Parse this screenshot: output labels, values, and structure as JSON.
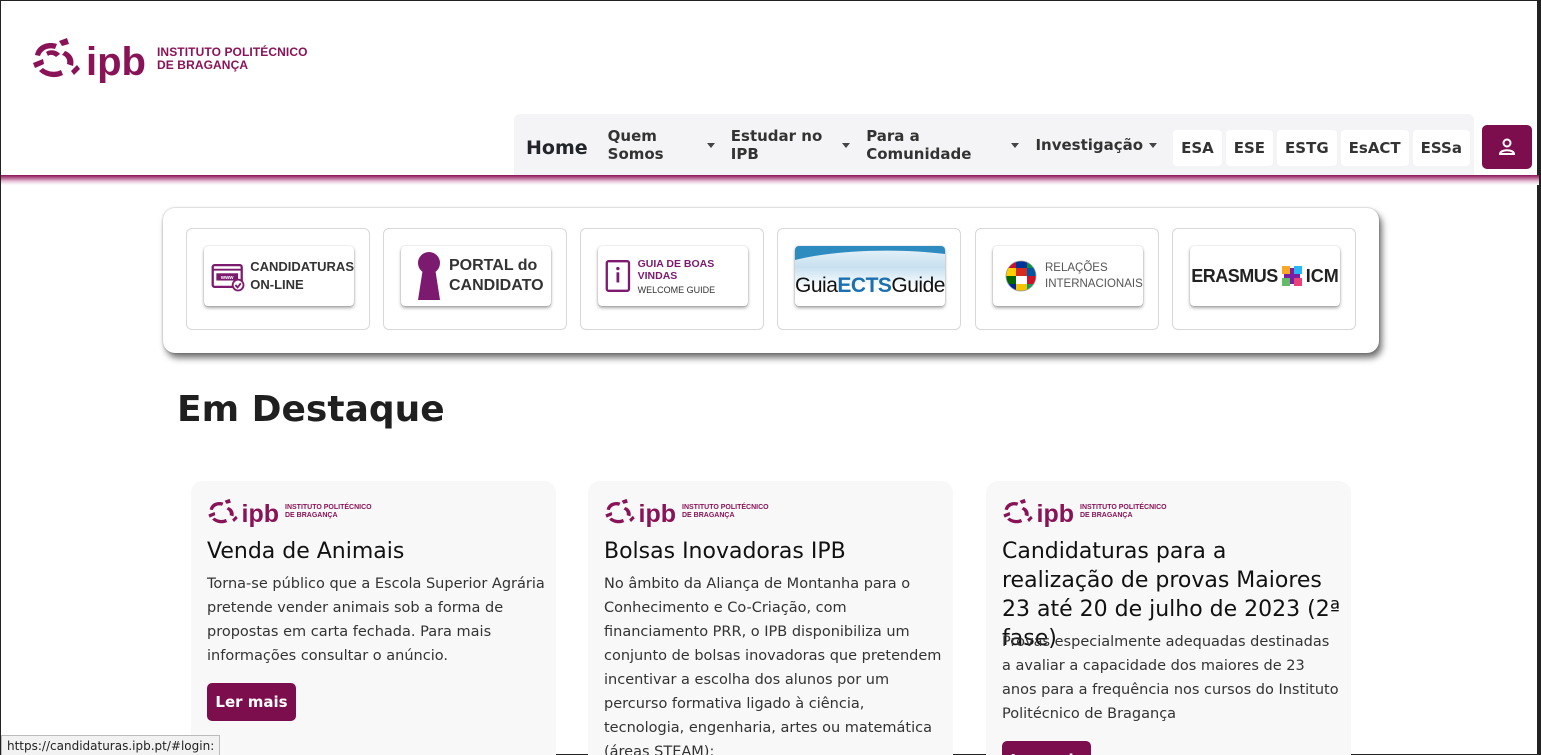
{
  "brand": {
    "name_line1": "INSTITUTO POLITÉCNICO",
    "name_line2": "DE BRAGANÇA",
    "color": "#8a1357"
  },
  "nav": {
    "home": "Home",
    "items": [
      "Quem Somos",
      "Estudar no IPB",
      "Para a Comunidade",
      "Investigação"
    ],
    "schools": [
      "ESA",
      "ESE",
      "ESTG",
      "EsACT",
      "ESSa"
    ],
    "user_icon": "user-icon"
  },
  "quick_links": [
    {
      "line1": "CANDIDATURAS",
      "line2": "ON-LINE"
    },
    {
      "line1": "PORTAL do",
      "line2": "CANDIDATO"
    },
    {
      "line1": "GUIA DE BOAS VINDAS",
      "line2": "WELCOME GUIDE"
    },
    {
      "line1": "Guia",
      "line2": "ECTS",
      "line3": "Guide"
    },
    {
      "line1": "RELAÇÕES",
      "line2": "INTERNACIONAIS"
    },
    {
      "line1": "ERASMUS",
      "line2": "ICM"
    }
  ],
  "section_title": "Em Destaque",
  "news": [
    {
      "title": "Venda de Animais",
      "text": "Torna-se público que a Escola Superior Agrária pretende vender animais sob a forma de propostas em carta fechada. Para mais informações consultar o anúncio.",
      "button": "Ler mais"
    },
    {
      "title": "Bolsas Inovadoras IPB",
      "text": "No âmbito da Aliança de Montanha para o Conhecimento e Co-Criação, com financiamento PRR, o IPB disponibiliza um conjunto de bolsas inovadoras que pretendem incentivar a escolha dos alunos por um percurso formativa ligado à ciência, tecnologia, engenharia, artes ou matemática (áreas STEAM):"
    },
    {
      "title": "Candidaturas para a realização de provas Maiores 23 até 20 de julho de 2023 (2ª fase)",
      "text": "Provas especialmente adequadas destinadas a avaliar a capacidade dos maiores de 23 anos para a frequência nos cursos do Instituto Politécnico de Bragança",
      "button": "Ler mais"
    }
  ],
  "status_url": "https://candidaturas.ipb.pt/#login:",
  "accent": "#7d0e4d"
}
